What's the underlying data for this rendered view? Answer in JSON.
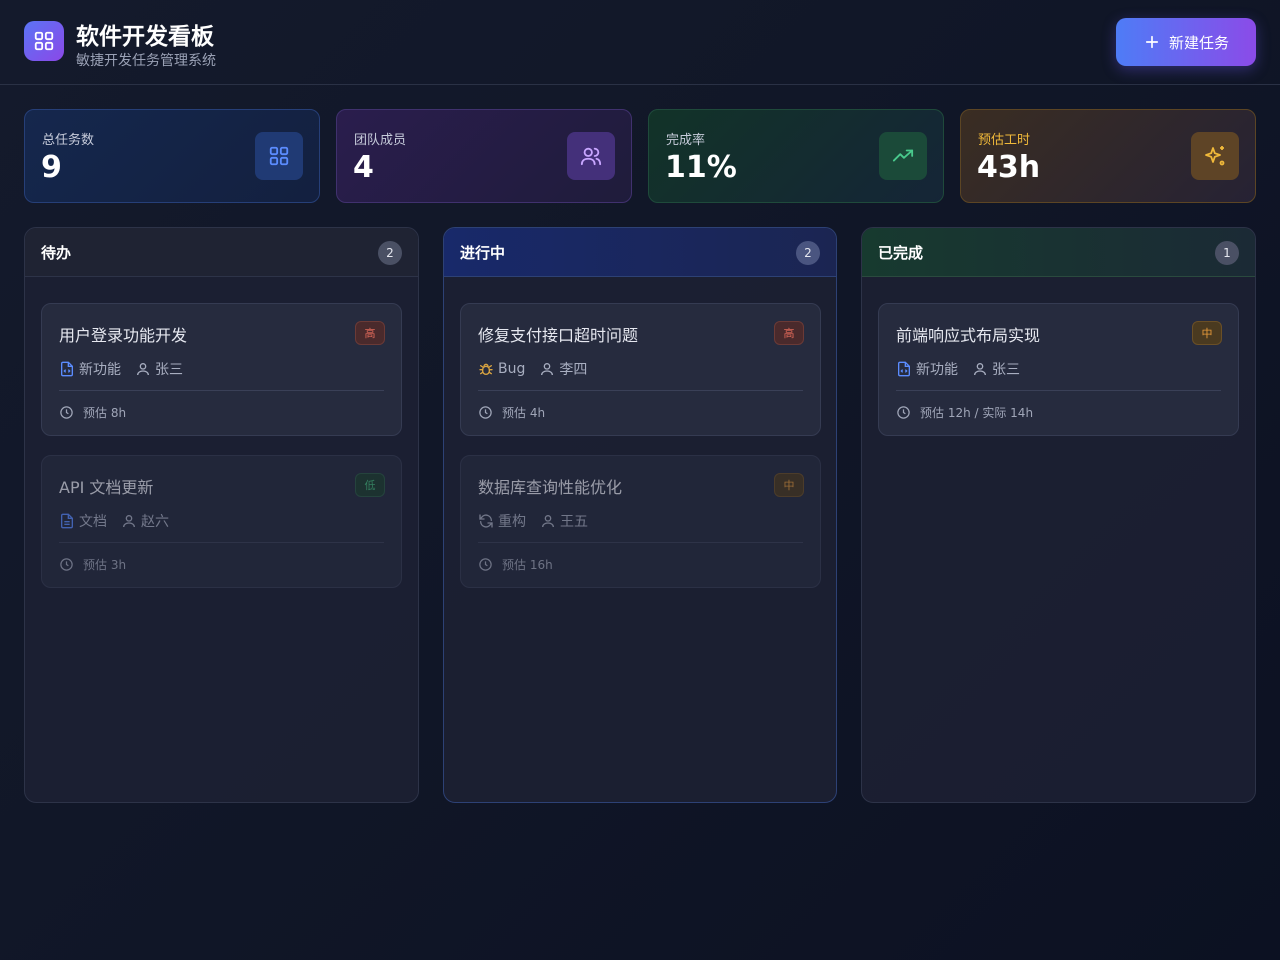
{
  "app": {
    "title": "软件开发看板",
    "subtitle": "敏捷开发任务管理系统",
    "new_task_label": "新建任务"
  },
  "stats": [
    {
      "label": "总任务数",
      "value": "9",
      "icon": "grid-icon"
    },
    {
      "label": "团队成员",
      "value": "4",
      "icon": "users-icon"
    },
    {
      "label": "完成率",
      "value": "11%",
      "icon": "trending-up-icon"
    },
    {
      "label": "预估工时",
      "value": "43h",
      "icon": "sparkles-icon"
    }
  ],
  "columns": [
    {
      "title": "待办",
      "count": "2",
      "cards": [
        {
          "title": "用户登录功能开发",
          "priority": "高",
          "type": "新功能",
          "type_icon": "file-code-icon",
          "assignee": "张三",
          "estimate": "预估 8h"
        },
        {
          "title": "API 文档更新",
          "priority": "低",
          "type": "文档",
          "type_icon": "file-text-icon",
          "assignee": "赵六",
          "estimate": "预估 3h"
        }
      ]
    },
    {
      "title": "进行中",
      "count": "2",
      "cards": [
        {
          "title": "修复支付接口超时问题",
          "priority": "高",
          "type": "Bug",
          "type_icon": "bug-icon",
          "assignee": "李四",
          "estimate": "预估 4h"
        },
        {
          "title": "数据库查询性能优化",
          "priority": "中",
          "type": "重构",
          "type_icon": "refresh-icon",
          "assignee": "王五",
          "estimate": "预估 16h"
        }
      ]
    },
    {
      "title": "已完成",
      "count": "1",
      "cards": [
        {
          "title": "前端响应式布局实现",
          "priority": "中",
          "type": "新功能",
          "type_icon": "file-code-icon",
          "assignee": "张三",
          "estimate": "预估 12h / 实际 14h"
        }
      ]
    }
  ],
  "colors": {
    "accent_blue": "#4e7cf6",
    "accent_purple": "#8b4be8",
    "priority_high": "#e06a5a",
    "priority_mid": "#e79a3a",
    "priority_low": "#43b97a",
    "hours_label": "#f0b93a"
  }
}
